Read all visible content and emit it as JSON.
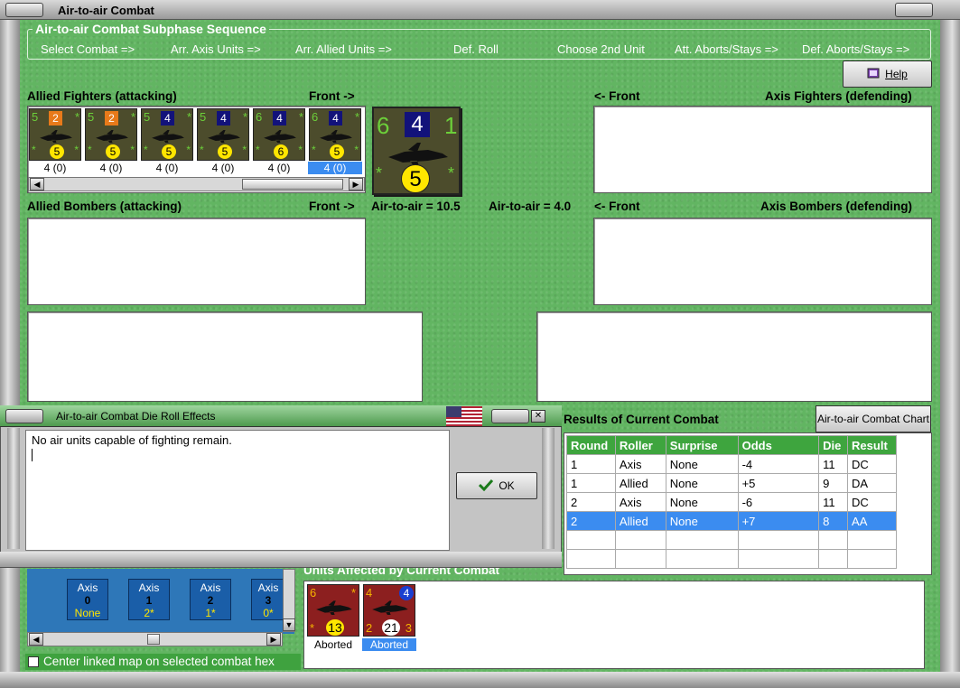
{
  "window": {
    "title": "Air-to-air Combat"
  },
  "sequence": {
    "title": "Air-to-air Combat Subphase Sequence",
    "steps": [
      "Select Combat =>",
      "Arr. Axis Units =>",
      "Arr. Allied Units =>",
      "Def. Roll",
      "Choose 2nd Unit",
      "Att. Aborts/Stays =>",
      "Def. Aborts/Stays =>"
    ]
  },
  "help": {
    "label": "Help"
  },
  "allied_fighters": {
    "label": "Allied Fighters (attacking)",
    "front": "Front ->",
    "counters": [
      {
        "left": "5",
        "mid": "2",
        "mid_color": "#e87a1a",
        "circle": "5",
        "caption": "4 (0)",
        "selected": false
      },
      {
        "left": "5",
        "mid": "2",
        "mid_color": "#e87a1a",
        "circle": "5",
        "caption": "4 (0)",
        "selected": false
      },
      {
        "left": "5",
        "mid": "4",
        "mid_color": "#12127a",
        "circle": "5",
        "caption": "4 (0)",
        "selected": false
      },
      {
        "left": "5",
        "mid": "4",
        "mid_color": "#12127a",
        "circle": "5",
        "caption": "4 (0)",
        "selected": false
      },
      {
        "left": "6",
        "mid": "4",
        "mid_color": "#12127a",
        "circle": "6",
        "caption": "4 (0)",
        "selected": false
      },
      {
        "left": "6",
        "mid": "4",
        "mid_color": "#12127a",
        "circle": "5",
        "caption": "4 (0)",
        "selected": true
      }
    ]
  },
  "big_counter": {
    "left": "6",
    "mid": "4",
    "right": "1",
    "circle": "5"
  },
  "axis_fighters": {
    "front": "<- Front",
    "label": "Axis Fighters (defending)"
  },
  "allied_bombers": {
    "label": "Allied Bombers (attacking)",
    "front": "Front ->",
    "a2a": "Air-to-air = 10.5"
  },
  "axis_bombers": {
    "a2a": "Air-to-air = 4.0",
    "front": "<- Front",
    "label": "Axis Bombers (defending)"
  },
  "dialog": {
    "title": "Air-to-air Combat Die Roll Effects",
    "message": "No air units capable of fighting remain.",
    "ok": "OK"
  },
  "results": {
    "title": "Results of Current Combat",
    "chart_button": "Air-to-air Combat Chart",
    "headers": [
      "Round",
      "Roller",
      "Surprise",
      "Odds",
      "Die",
      "Result"
    ],
    "rows": [
      [
        "1",
        "Axis",
        "None",
        "-4",
        "11",
        "DC"
      ],
      [
        "1",
        "Allied",
        "None",
        "+5",
        "9",
        "DA"
      ],
      [
        "2",
        "Axis",
        "None",
        "-6",
        "11",
        "DC"
      ],
      [
        "2",
        "Allied",
        "None",
        "+7",
        "8",
        "AA"
      ]
    ],
    "selected_row": 3
  },
  "hexes": [
    {
      "side": "Axis",
      "num": "0",
      "status": "None"
    },
    {
      "side": "Axis",
      "num": "1",
      "status": "2*"
    },
    {
      "side": "Axis",
      "num": "2",
      "status": "1*"
    },
    {
      "side": "Axis",
      "num": "3",
      "status": "0*"
    }
  ],
  "affected": {
    "title": "Units Affected by Current Combat",
    "units": [
      {
        "tl": "6",
        "tr": "*",
        "bl": "*",
        "circle": "13",
        "br": "",
        "caption": "Aborted",
        "selected": false
      },
      {
        "tl": "4",
        "tr": "4",
        "bl": "2",
        "circle": "21",
        "br": "3",
        "caption": "Aborted",
        "selected": true
      }
    ]
  },
  "center_map": {
    "label": "Center linked map on selected combat hex",
    "checked": false
  }
}
